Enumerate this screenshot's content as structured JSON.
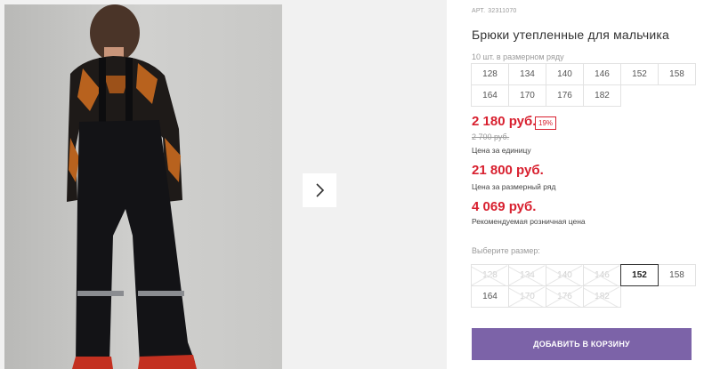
{
  "product": {
    "art_label": "АРТ.",
    "art_number": "32311070",
    "title": "Брюки утепленные для мальчика"
  },
  "size_row": {
    "label": "10 шт. в размерном ряду",
    "sizes": [
      "128",
      "134",
      "140",
      "146",
      "152",
      "158",
      "164",
      "170",
      "176",
      "182"
    ]
  },
  "prices": {
    "unit_price": "2 180 руб.",
    "discount": "19%",
    "old_price": "2 700 руб.",
    "unit_label": "Цена за единицу",
    "row_price": "21 800 руб.",
    "row_label": "Цена за размерный ряд",
    "rrp_price": "4 069 руб.",
    "rrp_label": "Рекомендуемая розничная цена"
  },
  "size_select": {
    "label": "Выберите размер:",
    "options": [
      {
        "size": "128",
        "state": "unavailable"
      },
      {
        "size": "134",
        "state": "unavailable"
      },
      {
        "size": "140",
        "state": "unavailable"
      },
      {
        "size": "146",
        "state": "unavailable"
      },
      {
        "size": "152",
        "state": "selected"
      },
      {
        "size": "158",
        "state": "available"
      },
      {
        "size": "164",
        "state": "available"
      },
      {
        "size": "170",
        "state": "unavailable"
      },
      {
        "size": "176",
        "state": "unavailable"
      },
      {
        "size": "182",
        "state": "unavailable"
      }
    ]
  },
  "cart_button": {
    "label": "ДОБАВИТЬ В КОРЗИНУ"
  },
  "gallery": {
    "next_icon": "chevron-right-icon"
  },
  "colors": {
    "accent": "#7c63a8",
    "price": "#d8202f"
  }
}
